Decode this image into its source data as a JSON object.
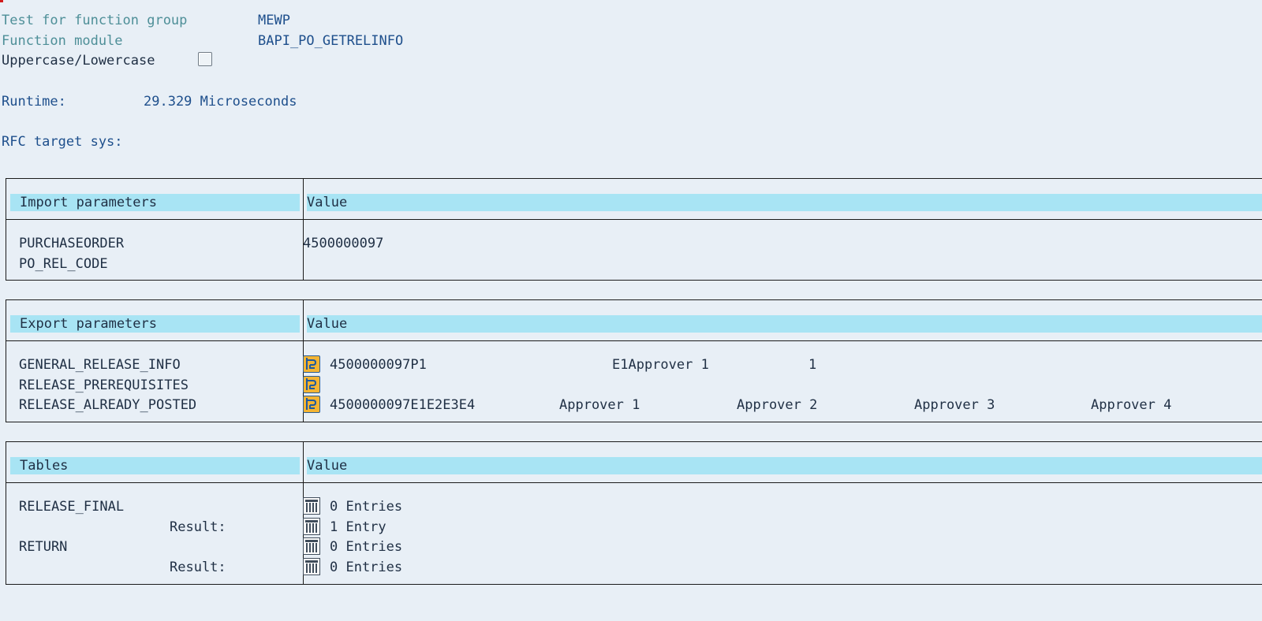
{
  "header": {
    "function_group_label": "Test for function group",
    "function_group_value": "MEWP",
    "function_module_label": "Function module",
    "function_module_value": "BAPI_PO_GETRELINFO",
    "case_label": "Uppercase/Lowercase",
    "case_checked": false
  },
  "runtime": {
    "label": "Runtime:",
    "value": "29.329 Microseconds"
  },
  "rfc": {
    "label": "RFC target sys:",
    "value": ""
  },
  "import_section": {
    "header_param": "Import parameters",
    "header_value": "Value",
    "rows": [
      {
        "name": "PURCHASEORDER",
        "value": "4500000097"
      },
      {
        "name": "PO_REL_CODE",
        "value": ""
      }
    ]
  },
  "export_section": {
    "header_param": "Export parameters",
    "header_value": "Value",
    "rows": [
      {
        "name": "GENERAL_RELEASE_INFO",
        "icon": "structure-icon",
        "fields": [
          "4500000097P1",
          "E1Approver 1",
          "1"
        ]
      },
      {
        "name": "RELEASE_PREREQUISITES",
        "icon": "structure-icon",
        "fields": []
      },
      {
        "name": "RELEASE_ALREADY_POSTED",
        "icon": "structure-icon",
        "fields": [
          "4500000097E1E2E3E4",
          "Approver 1",
          "Approver 2",
          "Approver 3",
          "Approver 4"
        ]
      }
    ]
  },
  "tables_section": {
    "header_param": "Tables",
    "header_value": "Value",
    "rows": [
      {
        "name": "RELEASE_FINAL",
        "icon": "table-icon",
        "value": "0 Entries"
      },
      {
        "name": "Result:",
        "icon": "table-icon",
        "value": "1 Entry"
      },
      {
        "name": "RETURN",
        "icon": "table-icon",
        "value": "0 Entries"
      },
      {
        "name": "Result:",
        "icon": "table-icon",
        "value": "0 Entries"
      }
    ]
  },
  "colors": {
    "background": "#e8eff6",
    "header_bar": "#a8e4f4",
    "label_teal": "#4e8f98",
    "value_blue": "#1e4f8c",
    "icon_orange": "#f3b433"
  }
}
